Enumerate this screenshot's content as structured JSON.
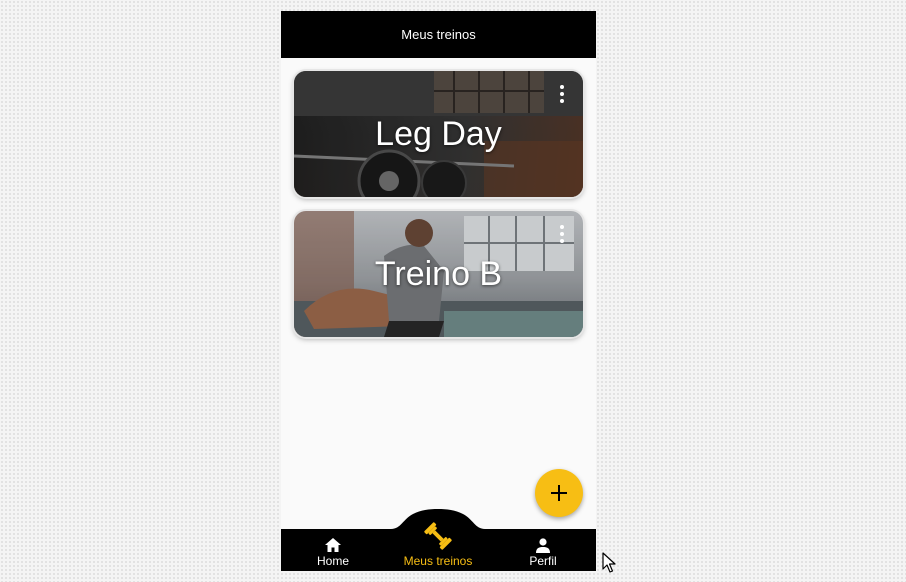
{
  "app": {
    "title": "Meus treinos"
  },
  "workouts": [
    {
      "name": "Leg Day"
    },
    {
      "name": "Treino B"
    }
  ],
  "fab": {
    "icon": "plus-icon"
  },
  "bottom_nav": {
    "items": [
      {
        "label": "Home",
        "icon": "home-icon",
        "active": false
      },
      {
        "label": "Meus treinos",
        "icon": "dumbbell-icon",
        "active": true
      },
      {
        "label": "Perfil",
        "icon": "person-icon",
        "active": false
      }
    ]
  },
  "colors": {
    "accent": "#f7be14",
    "bar": "#000000",
    "background": "#fafafa"
  }
}
